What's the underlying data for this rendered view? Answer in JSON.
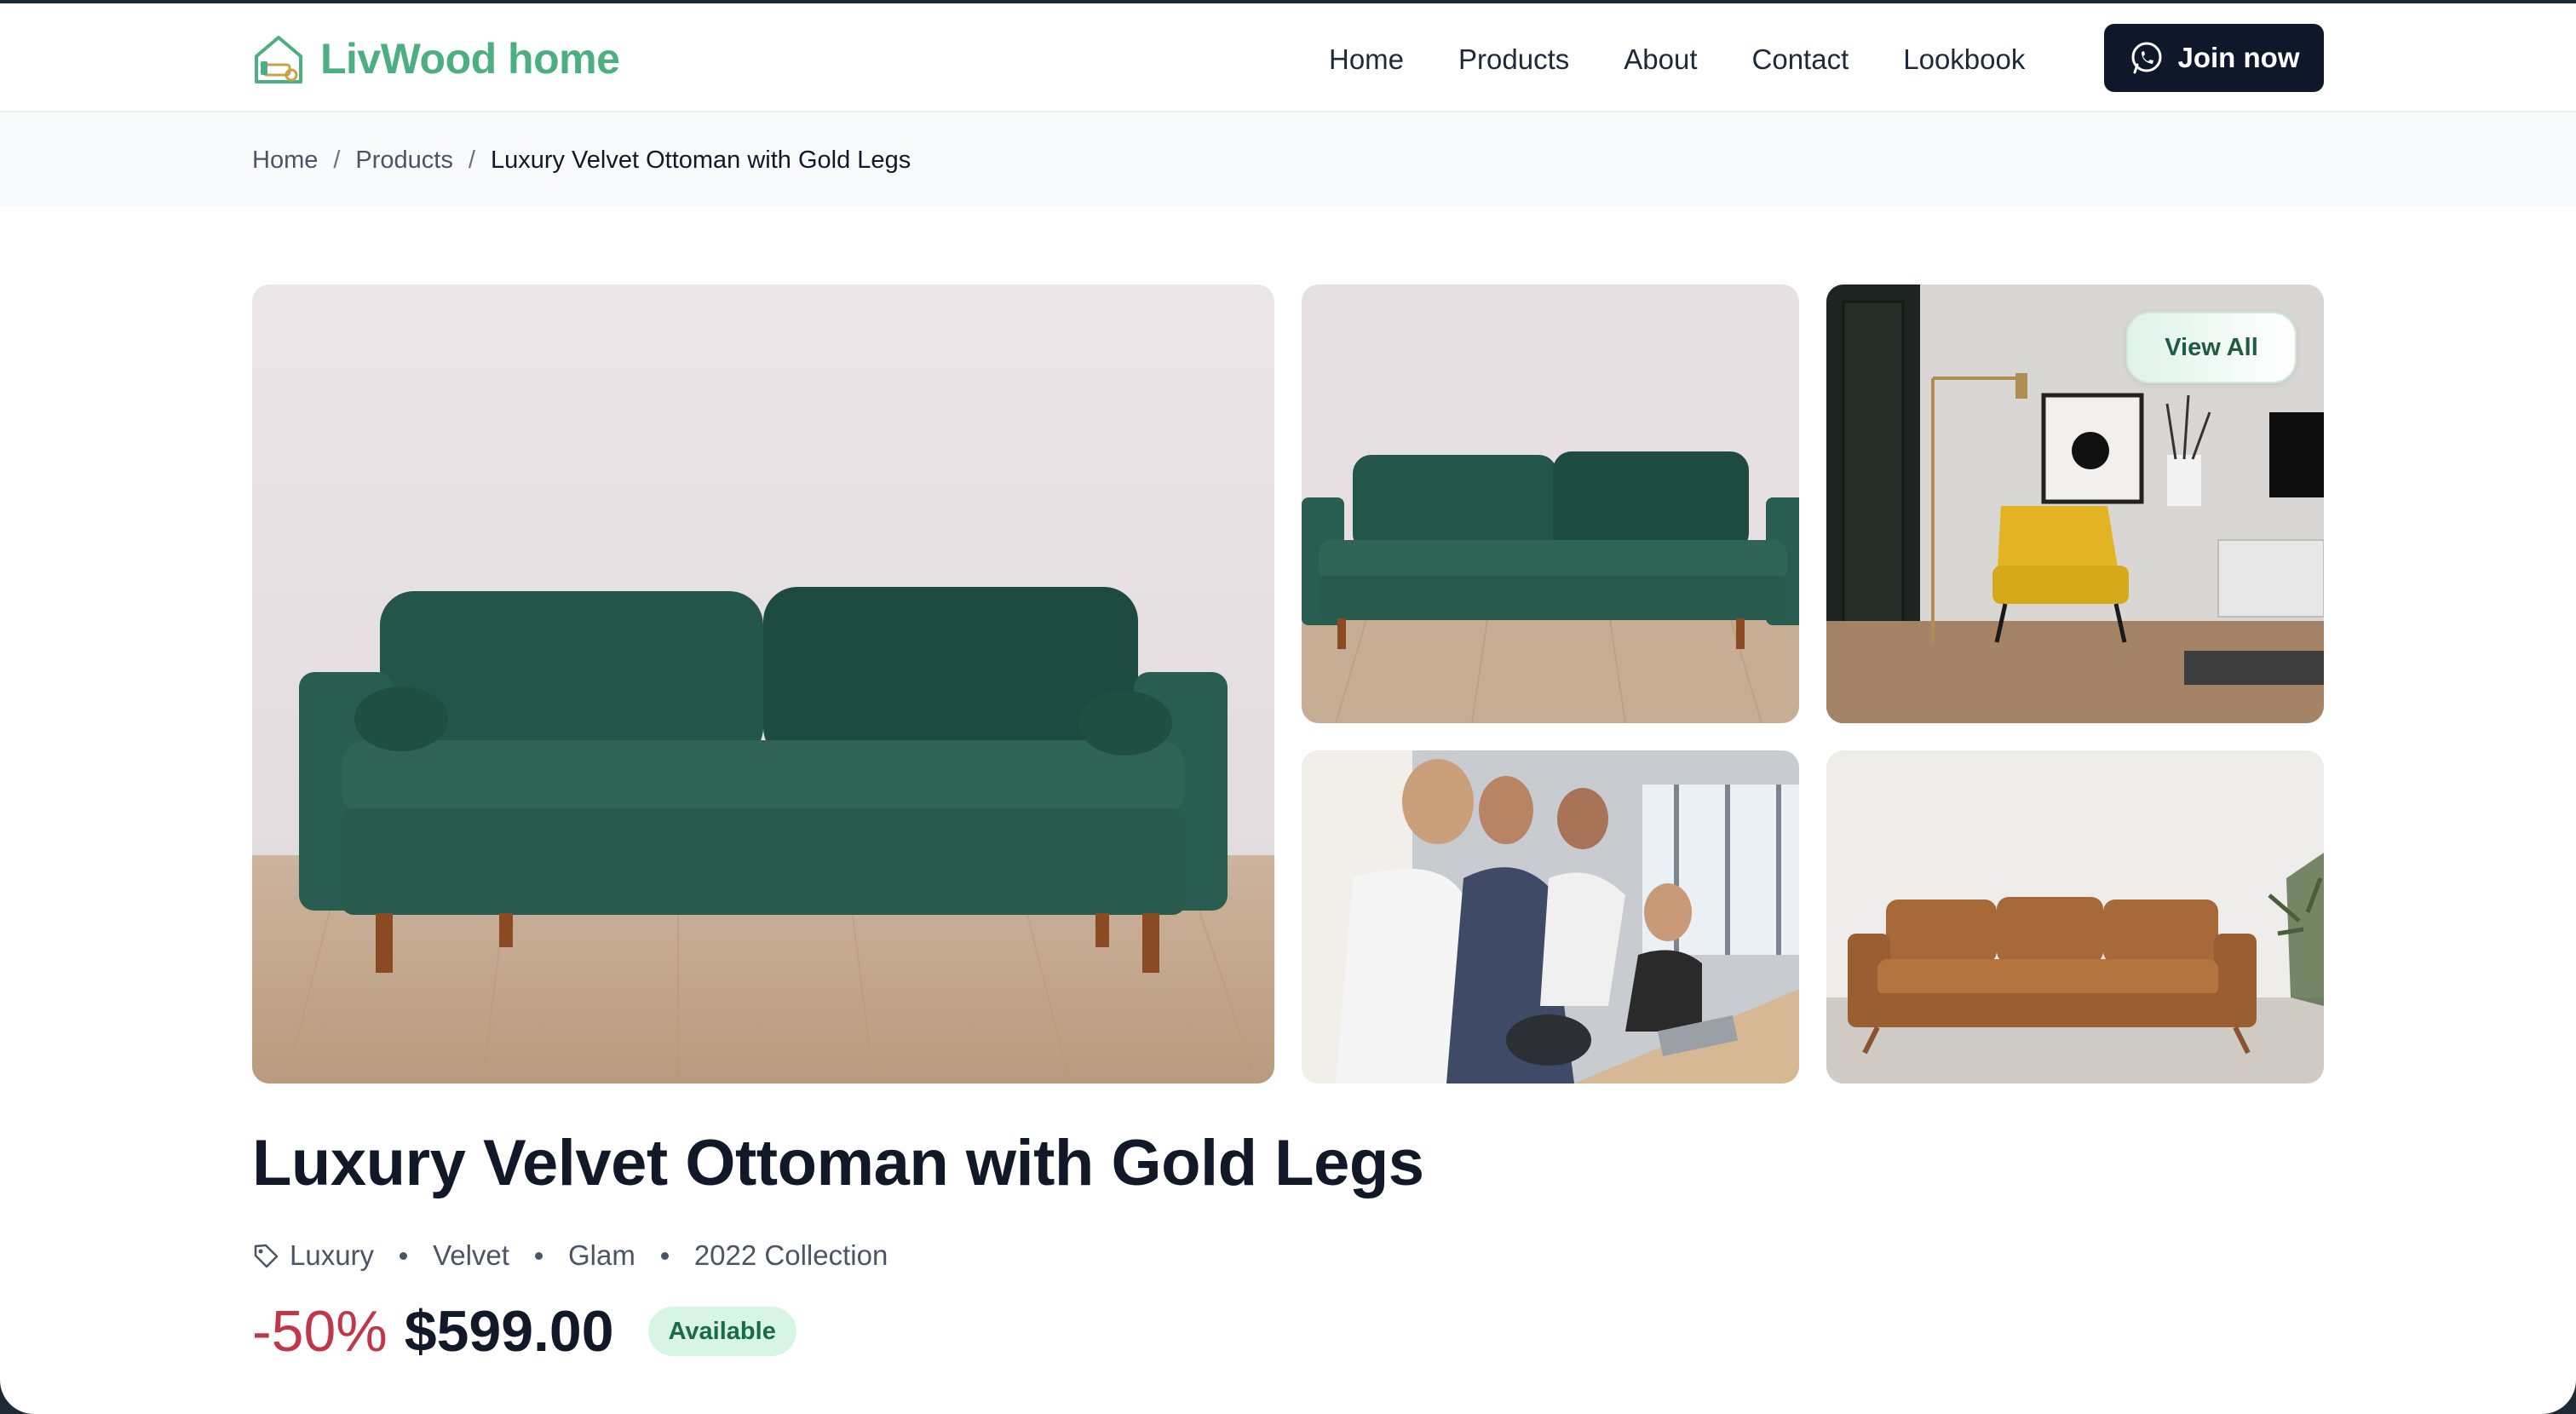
{
  "header": {
    "brand": "LivWood home",
    "nav": [
      "Home",
      "Products",
      "About",
      "Contact",
      "Lookbook"
    ],
    "join_label": "Join now"
  },
  "breadcrumb": {
    "items": [
      "Home",
      "Products",
      "Luxury Velvet Ottoman with Gold Legs"
    ],
    "separator": "/"
  },
  "gallery": {
    "view_all_label": "View All",
    "images": [
      "green-velvet-sofa",
      "green-velvet-sofa-alt",
      "yellow-armchair-living-room",
      "team-at-office-desk",
      "tan-leather-sofa"
    ]
  },
  "product": {
    "title": "Luxury Velvet Ottoman with Gold Legs",
    "tags": [
      "Luxury",
      "Velvet",
      "Glam",
      "2022 Collection"
    ],
    "discount": "-50%",
    "price": "$599.00",
    "status": "Available"
  },
  "colors": {
    "brand_green": "#4caf82",
    "dark": "#0f172a",
    "discount_red": "#c0374a",
    "badge_bg": "#d8f5e4"
  }
}
